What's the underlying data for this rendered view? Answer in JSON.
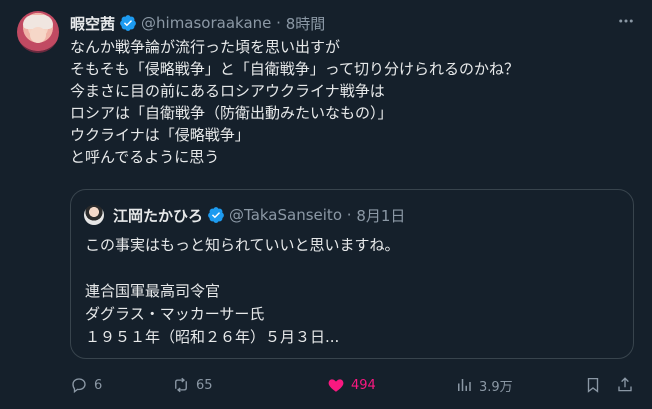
{
  "tweet": {
    "author_name": "暇空茜",
    "author_handle": "@himasoraakane",
    "time": "8時間",
    "text": "なんか戦争論が流行った頃を思い出すが\nそもそも「侵略戦争」と「自衛戦争」って切り分けられるのかね？\n今まさに目の前にあるロシアウクライナ戦争は\nロシアは「自衛戦争（防衛出動みたいなもの）」\nウクライナは「侵略戦争」\nと呼んでるように思う"
  },
  "quote": {
    "author_name": "江岡たかひろ",
    "author_handle": "@TakaSanseito",
    "date": "8月1日",
    "text": "この事実はもっと知られていいと思いますね。\n\n連合国軍最高司令官\nダグラス・マッカーサー氏\n１９５１年（昭和２６年）５月３日..."
  },
  "actions": {
    "replies": "6",
    "retweets": "65",
    "likes": "494",
    "views": "3.9万"
  },
  "colors": {
    "background": "#15202b",
    "text": "#e7e9ea",
    "muted": "#8b98a5",
    "like": "#f91880",
    "verified": "#1d9bf0",
    "border": "#38444d"
  }
}
